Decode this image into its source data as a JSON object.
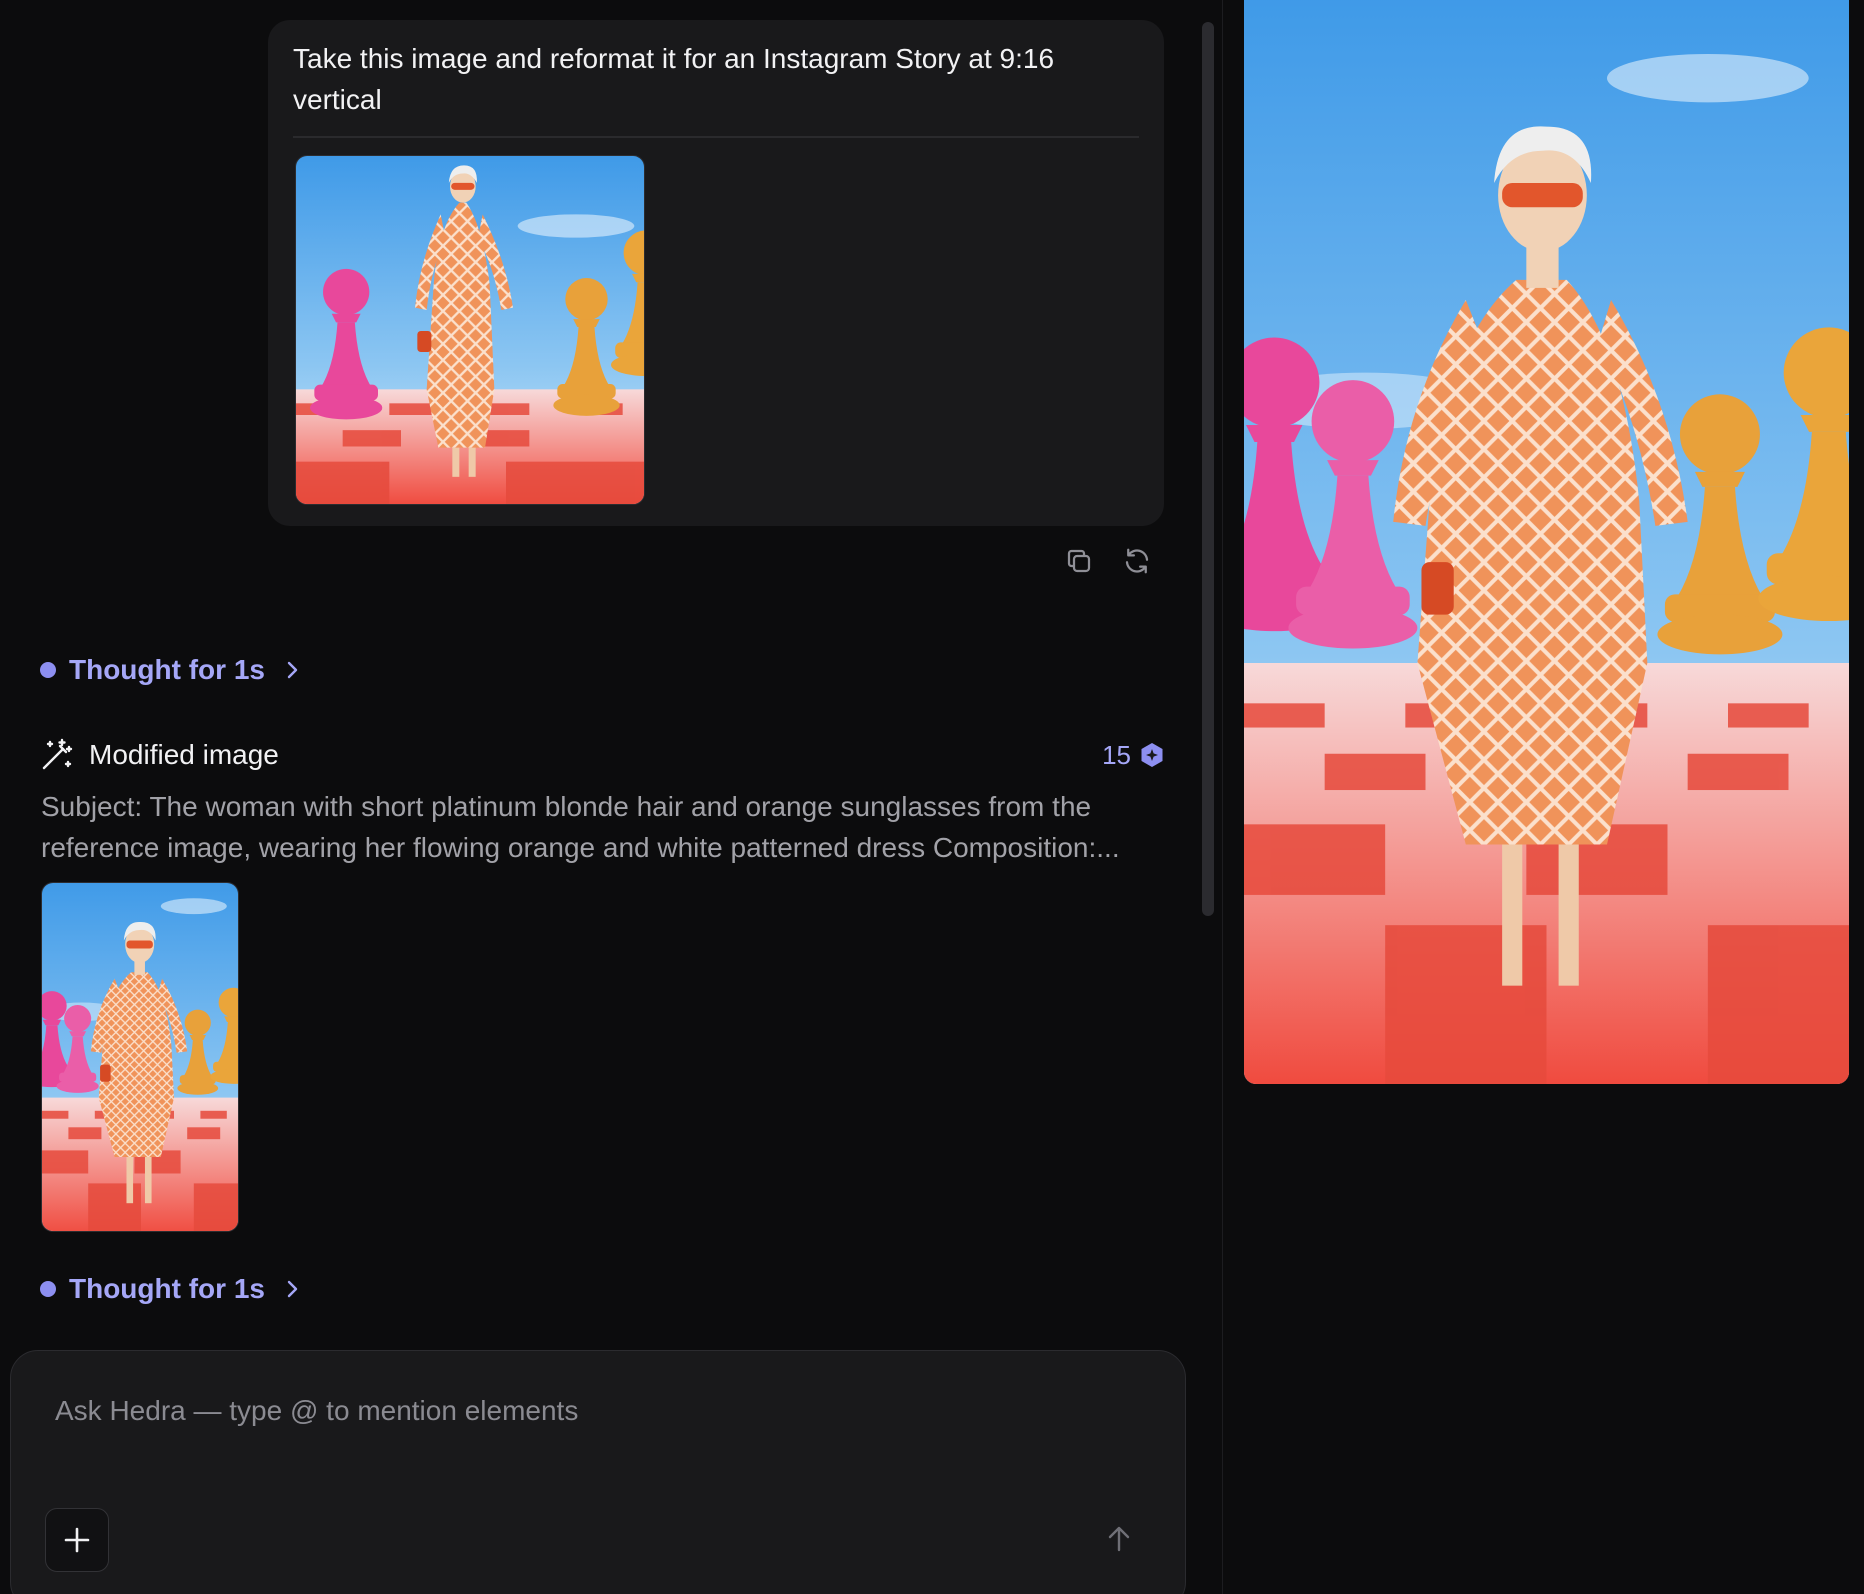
{
  "user_message": {
    "text": "Take this image and reformat it for an Instagram Story at 9:16 vertical"
  },
  "actions": {
    "copy_icon": "copy-icon",
    "retry_icon": "refresh-icon"
  },
  "thought_1": {
    "label": "Thought for 1s"
  },
  "tool_call": {
    "title": "Modified image",
    "credits": "15",
    "description": "Subject: The woman with short platinum blonde hair and orange sunglasses from the reference image, wearing her flowing orange and white patterned dress Composition:..."
  },
  "thought_2": {
    "label": "Thought for 1s"
  },
  "composer": {
    "placeholder": "Ask Hedra — type @ to mention elements"
  },
  "colors": {
    "accent": "#8d8ff0",
    "background": "#0c0c0d",
    "panel": "#19191b"
  }
}
